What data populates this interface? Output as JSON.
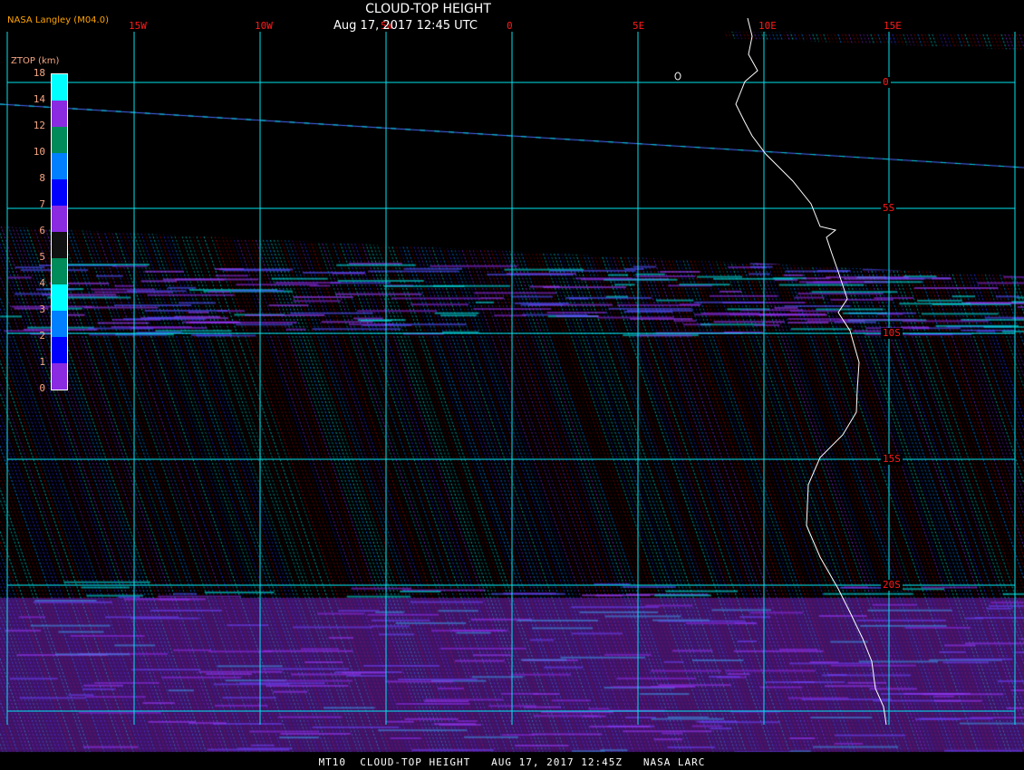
{
  "header": {
    "title": "CLOUD-TOP HEIGHT",
    "subtitle": "Aug 17, 2017 12:45 UTC",
    "credit": "NASA Langley (M04.0)"
  },
  "longitude_labels": [
    "15W",
    "10W",
    "5W",
    "0",
    "5E",
    "10E",
    "15E"
  ],
  "latitude_labels": [
    "0",
    "5S",
    "10S",
    "15S",
    "20S"
  ],
  "colorbar": {
    "title": "ZTOP (km)",
    "tick_labels": [
      "0",
      "1",
      "2",
      "3",
      "4",
      "5",
      "6",
      "7",
      "8",
      "10",
      "12",
      "14",
      "18"
    ],
    "colors": [
      "#8a2be2",
      "#0000ff",
      "#0080ff",
      "#00ffff",
      "#008b5a",
      "#111111",
      "#8a2be2",
      "#0000ff",
      "#0080ff",
      "#008b5a",
      "#8a2be2",
      "#00ffff"
    ]
  },
  "colors": {
    "grid": "#00e5ee",
    "labels": "#ff1a1a",
    "coastline": "#ffffff"
  },
  "footer": "MT10  CLOUD-TOP HEIGHT   AUG 17, 2017 12:45Z   NASA LARC"
}
